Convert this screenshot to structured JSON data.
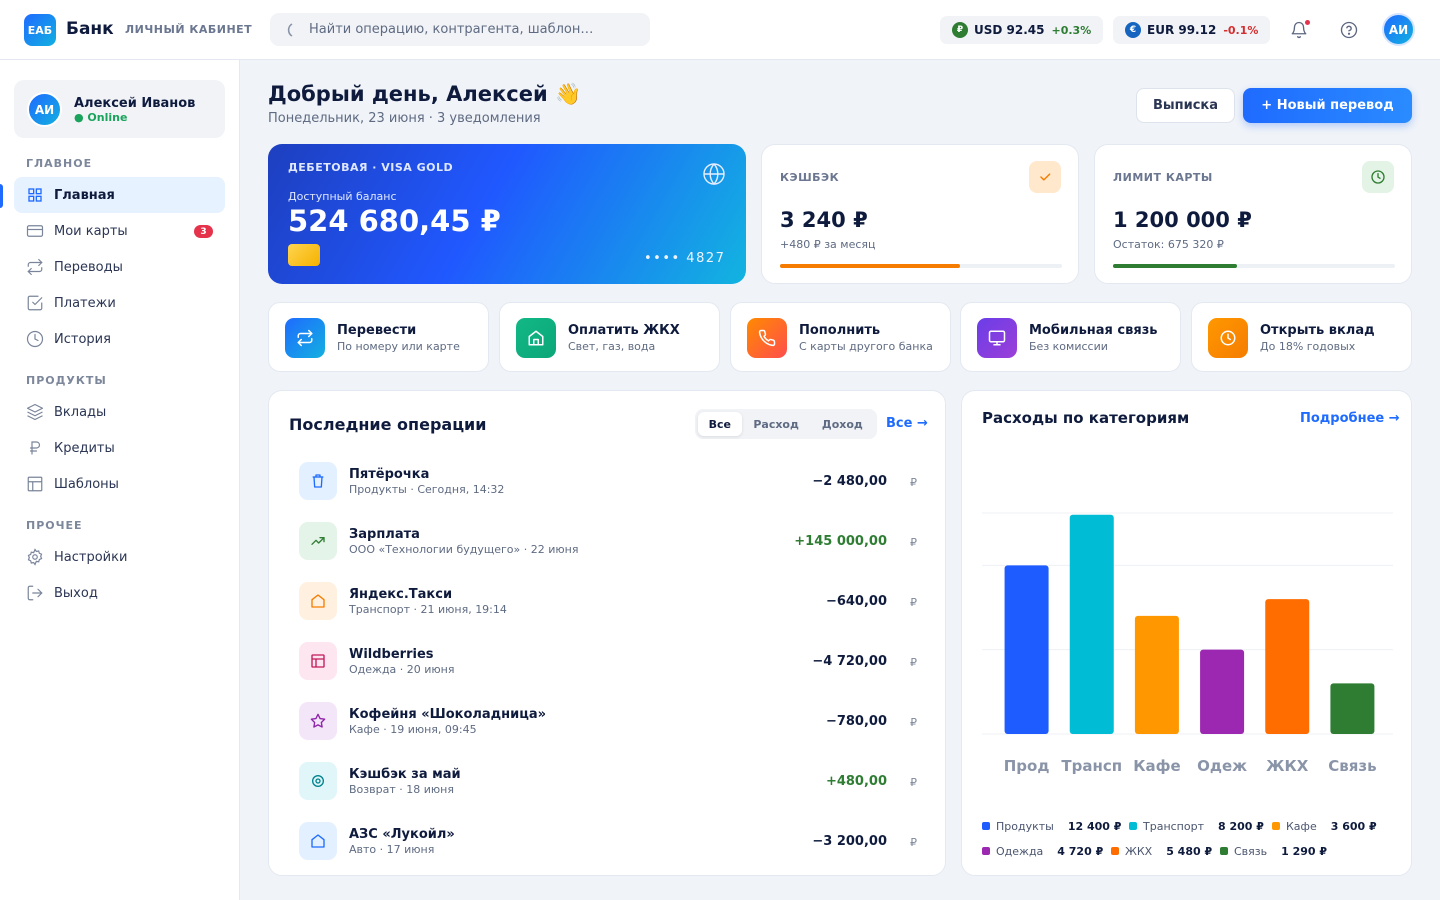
{
  "header": {
    "logo": "ЕАБ",
    "brand": "Банк",
    "section": "ЛИЧНЫЙ КАБИНЕТ",
    "search_placeholder": "Найти операцию, контрагента, шаблон…",
    "rates": [
      {
        "symbol": "₽",
        "label": "USD 92.45",
        "change": "+0.3%",
        "color": "#2e7d32",
        "change_color": "#2e7d32"
      },
      {
        "symbol": "€",
        "label": "EUR 99.12",
        "change": "-0.1%",
        "color": "#1565c0",
        "change_color": "#d32f2f"
      }
    ],
    "avatar": "АИ"
  },
  "sidebar": {
    "user": {
      "initials": "АИ",
      "name": "Алексей Иванов",
      "status": "● Online"
    },
    "sections": [
      "ГЛАВНОЕ",
      "ПРОДУКТЫ",
      "ПРОЧЕЕ"
    ],
    "items": [
      {
        "label": "Главная",
        "icon": "grid-icon"
      },
      {
        "label": "Мои карты",
        "icon": "card-icon",
        "badge": "3"
      },
      {
        "label": "Переводы",
        "icon": "transfer-icon"
      },
      {
        "label": "Платежи",
        "icon": "check-square-icon"
      },
      {
        "label": "История",
        "icon": "clock-icon"
      },
      {
        "label": "Вклады",
        "icon": "layers-icon"
      },
      {
        "label": "Кредиты",
        "icon": "ruble-icon"
      },
      {
        "label": "Шаблоны",
        "icon": "template-icon"
      },
      {
        "label": "Настройки",
        "icon": "gear-icon"
      },
      {
        "label": "Выход",
        "icon": "logout-icon"
      }
    ]
  },
  "main": {
    "greeting": "Добрый день, Алексей 👋",
    "subtitle": "Понедельник, 23 июня · 3 уведомления",
    "statement_button": "Выписка",
    "new_transfer_button": "+  Новый перевод",
    "card": {
      "type": "ДЕБЕТОВАЯ · VISA GOLD",
      "balance_label": "Доступный баланс",
      "balance": "524 680,45 ₽",
      "number": "•••• 4827"
    },
    "stats": [
      {
        "title": "КЭШБЭК",
        "value": "3 240 ₽",
        "sub": "+480 ₽ за месяц",
        "progress": 0.64,
        "color": "#f57c00",
        "icon_bg": "#ffe8cc",
        "icon_color": "#f57c00"
      },
      {
        "title": "ЛИМИТ КАРТЫ",
        "value": "1 200 000 ₽",
        "sub": "Остаток: 675 320 ₽",
        "progress": 0.44,
        "color": "#2e7d32",
        "icon_bg": "#e3f3e5",
        "icon_color": "#2e7d32"
      }
    ],
    "quick_actions": [
      {
        "title": "Перевести",
        "sub": "По номеру или карте",
        "icon": "transfer-icon",
        "bg": "linear-gradient(135deg,#1f6bff,#12b0e0)"
      },
      {
        "title": "Оплатить ЖКХ",
        "sub": "Свет, газ, вода",
        "icon": "home-icon",
        "bg": "linear-gradient(135deg,#12b886,#0ca678)"
      },
      {
        "title": "Пополнить",
        "sub": "С карты другого банка",
        "icon": "phone-icon",
        "bg": "linear-gradient(135deg,#ff8a00,#ff4d4d)"
      },
      {
        "title": "Мобильная связь",
        "sub": "Без комиссии",
        "icon": "monitor-icon",
        "bg": "linear-gradient(135deg,#6a3de8,#9c3fd8)"
      },
      {
        "title": "Открыть вклад",
        "sub": "До 18% годовых",
        "icon": "clock-icon",
        "bg": "linear-gradient(135deg,#ff9800,#f57c00)"
      }
    ],
    "operations": {
      "title": "Последние операции",
      "filters": [
        "Все",
        "Расход",
        "Доход"
      ],
      "all_link": "Все →",
      "currency": "₽",
      "rows": [
        {
          "name": "Пятёрочка",
          "sub": "Продукты · Сегодня, 14:32",
          "amount": "−2 480,00",
          "icon": "trash-icon",
          "bg": "#e3f0ff",
          "fg": "#1f6bff",
          "color": "#0f1b3d"
        },
        {
          "name": "Зарплата",
          "sub": "ООО «Технологии будущего» · 22 июня",
          "amount": "+145 000,00",
          "icon": "trend-up-icon",
          "bg": "#e5f4e8",
          "fg": "#2e7d32",
          "color": "#2e7d32"
        },
        {
          "name": "Яндекс.Такси",
          "sub": "Транспорт · 21 июня, 19:14",
          "amount": "−640,00",
          "icon": "home-icon",
          "bg": "#fff0df",
          "fg": "#f57c00",
          "color": "#0f1b3d"
        },
        {
          "name": "Wildberries",
          "sub": "Одежда · 20 июня",
          "amount": "−4 720,00",
          "icon": "template-icon",
          "bg": "#fde6ef",
          "fg": "#c2185b",
          "color": "#0f1b3d"
        },
        {
          "name": "Кофейня «Шоколадница»",
          "sub": "Кафе · 19 июня, 09:45",
          "amount": "−780,00",
          "icon": "star-icon",
          "bg": "#f4e6f9",
          "fg": "#8e24aa",
          "color": "#0f1b3d"
        },
        {
          "name": "Кэшбэк за май",
          "sub": "Возврат · 18 июня",
          "amount": "+480,00",
          "icon": "target-icon",
          "bg": "#e0f6f8",
          "fg": "#00838f",
          "color": "#2e7d32"
        },
        {
          "name": "АЗС «Лукойл»",
          "sub": "Авто · 17 июня",
          "amount": "−3 200,00",
          "icon": "home-icon",
          "bg": "#e3f0ff",
          "fg": "#1f6bff",
          "color": "#0f1b3d"
        }
      ]
    },
    "categories": {
      "title": "Расходы по категориям",
      "more_link": "Подробнее →",
      "legend": [
        {
          "name": "Продукты",
          "value": "12 400 ₽",
          "color": "#1f5cff"
        },
        {
          "name": "Транспорт",
          "value": "8 200 ₽",
          "color": "#00bcd4"
        },
        {
          "name": "Кафе",
          "value": "3 600 ₽",
          "color": "#ff9800"
        },
        {
          "name": "Одежда",
          "value": "4 720 ₽",
          "color": "#9c27b0"
        },
        {
          "name": "ЖКХ",
          "value": "5 480 ₽",
          "color": "#ff6d00"
        },
        {
          "name": "Связь",
          "value": "1 290 ₽",
          "color": "#2e7d32"
        }
      ]
    }
  },
  "chart_data": {
    "type": "bar",
    "categories": [
      "Прод",
      "Трансп",
      "Кафе",
      "Одеж",
      "ЖКХ",
      "Связь"
    ],
    "values": [
      10000,
      13000,
      7000,
      5000,
      8000,
      3000
    ],
    "colors": [
      "#1f5cff",
      "#00bcd4",
      "#ff9800",
      "#9c27b0",
      "#ff6d00",
      "#2e7d32"
    ],
    "ylim": [
      0,
      15000
    ],
    "grid": true
  }
}
